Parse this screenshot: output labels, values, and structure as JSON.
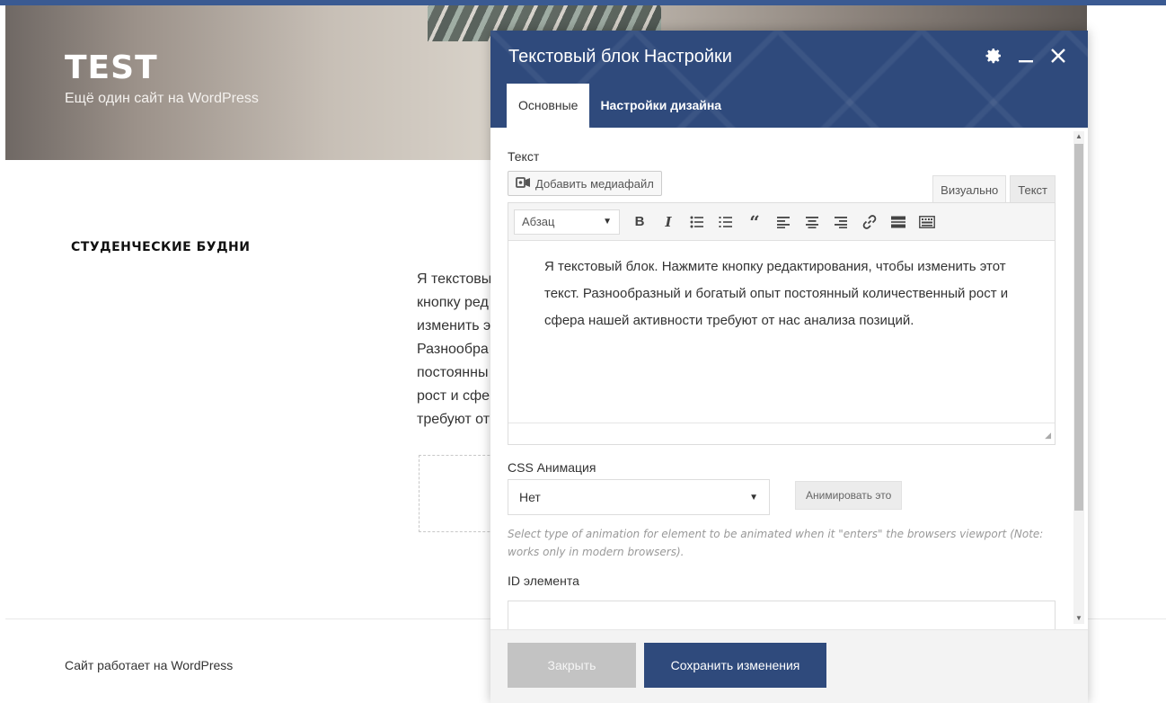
{
  "site": {
    "title": "TEST",
    "description": "Ещё один сайт на WordPress",
    "section_title": "СТУДЕНЧЕСКИЕ БУДНИ",
    "bg_text_lines": [
      "Я текстовый",
      "кнопку ред",
      "изменить э",
      "Разнообра",
      "постоянны",
      "рост и сфе",
      "требуют от"
    ],
    "footer": "Сайт работает на WordPress"
  },
  "modal": {
    "title": "Текстовый блок Настройки",
    "icons": [
      "gear-icon",
      "minimize-icon",
      "close-icon"
    ],
    "tabs": [
      {
        "label": "Основные",
        "active": true
      },
      {
        "label": "Настройки дизайна",
        "active": false
      }
    ],
    "text_field": {
      "label": "Текст",
      "add_media_label": "Добавить медиафайл",
      "mode_tabs": [
        {
          "label": "Визуально",
          "active": true
        },
        {
          "label": "Текст",
          "active": false
        }
      ],
      "format_value": "Абзац",
      "toolbar_icons": [
        "bold-icon",
        "italic-icon",
        "bullet-list-icon",
        "numbered-list-icon",
        "blockquote-icon",
        "align-left-icon",
        "align-center-icon",
        "align-right-icon",
        "link-icon",
        "read-more-icon",
        "toolbar-toggle-icon"
      ],
      "content": "Я текстовый блок. Нажмите кнопку редактирования, чтобы изменить этот текст. Разнообразный и богатый опыт постоянный количественный рост и сфера нашей активности требуют от нас анализа позиций."
    },
    "animation": {
      "label": "CSS Анимация",
      "selected": "Нет",
      "button_label": "Анимировать это",
      "help": "Select type of animation for element to be animated when it \"enters\" the browsers viewport (Note: works only in modern browsers)."
    },
    "element_id": {
      "label": "ID элемента",
      "value": ""
    },
    "footer": {
      "close_label": "Закрыть",
      "save_label": "Сохранить изменения"
    }
  }
}
